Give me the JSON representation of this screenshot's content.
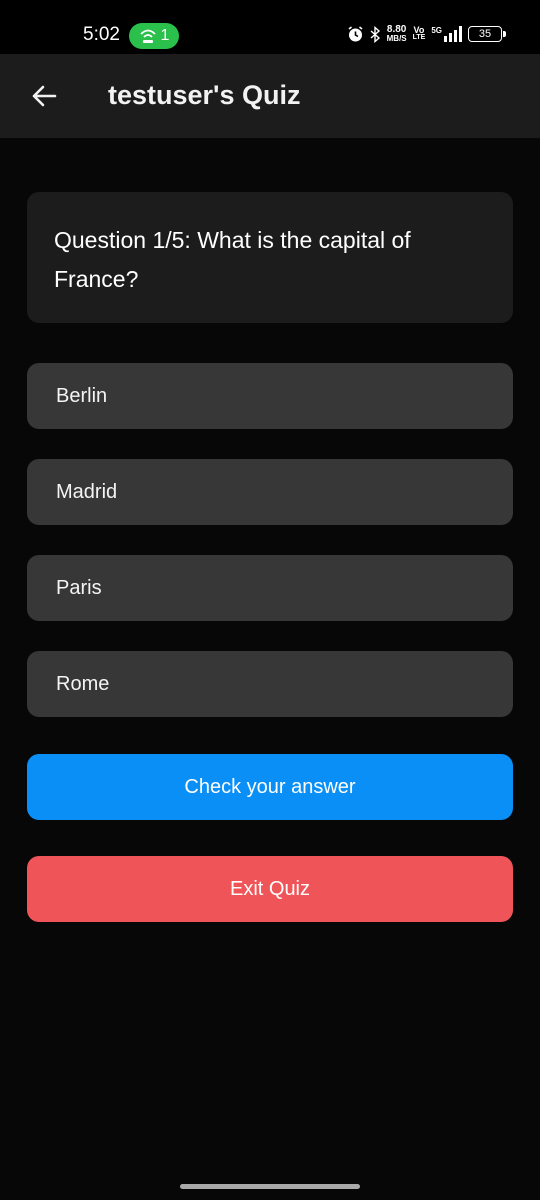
{
  "status_bar": {
    "time": "5:02",
    "hotspot_count": "1",
    "net_speed_value": "8.80",
    "net_speed_unit": "MB/S",
    "volte_top": "Vo",
    "volte_bottom": "LTE",
    "network": "5G",
    "battery": "35",
    "colors": {
      "hotspot": "#2bbf4b"
    }
  },
  "app_bar": {
    "title": "testuser's Quiz",
    "back_icon": "arrow-left-icon"
  },
  "question": {
    "text": "Question 1/5: What is the capital of France?"
  },
  "options": [
    "Berlin",
    "Madrid",
    "Paris",
    "Rome"
  ],
  "actions": {
    "check_label": "Check your answer",
    "exit_label": "Exit Quiz"
  },
  "colors": {
    "background": "#070707",
    "card": "#1c1c1c",
    "option": "#373737",
    "check_button": "#0a8ff7",
    "exit_button": "#ef5558"
  }
}
